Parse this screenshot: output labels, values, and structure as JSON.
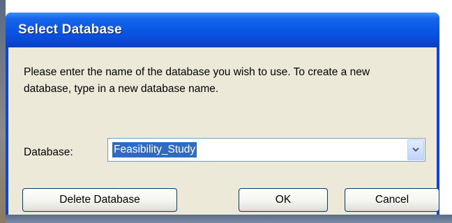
{
  "window": {
    "title": "Select Database"
  },
  "dialog": {
    "message": "Please enter the name of the database you wish to use.  To create a new database, type in a new database name.",
    "database_label": "Database:",
    "database_value": "Feasibility_Study"
  },
  "buttons": {
    "delete_label": "Delete Database",
    "ok_label": "OK",
    "cancel_label": "Cancel"
  },
  "icons": {
    "combo_arrow": "chevron-down-icon"
  },
  "colors": {
    "titlebar": "#0a55e4",
    "selection": "#316ac5",
    "client_bg": "#ece9d8"
  }
}
